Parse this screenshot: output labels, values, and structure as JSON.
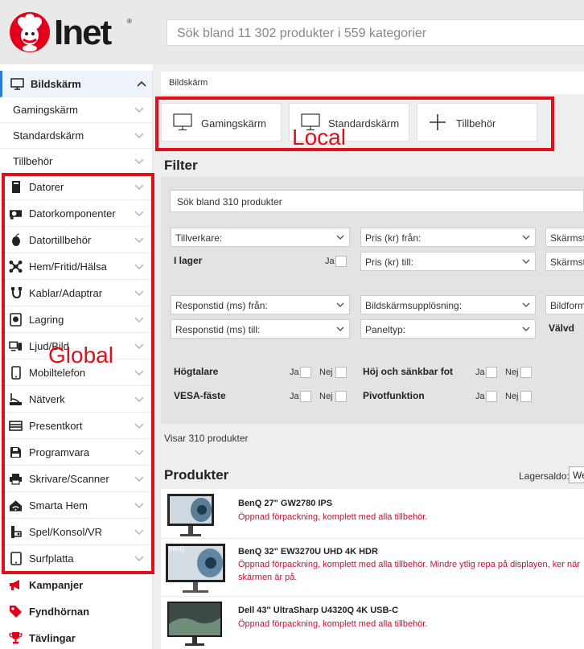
{
  "header": {
    "logo_text": "Inet",
    "logo_mark": "®",
    "search_placeholder": "Sök bland 11 302 produkter i 559 kategorier"
  },
  "sidebar": {
    "current": {
      "label": "Bildskärm",
      "icon": "monitor-icon"
    },
    "subcategories": [
      "Gamingskärm",
      "Standardskärm",
      "Tillbehör"
    ],
    "categories": [
      {
        "label": "Datorer",
        "icon": "desktop-tower-icon"
      },
      {
        "label": "Datorkomponenter",
        "icon": "graphics-card-icon"
      },
      {
        "label": "Datortillbehör",
        "icon": "mouse-icon"
      },
      {
        "label": "Hem/Fritid/Hälsa",
        "icon": "drone-icon"
      },
      {
        "label": "Kablar/Adaptrar",
        "icon": "cable-icon"
      },
      {
        "label": "Lagring",
        "icon": "hard-drive-icon"
      },
      {
        "label": "Ljud/Bild",
        "icon": "speaker-tv-icon"
      },
      {
        "label": "Mobiltelefon",
        "icon": "phone-icon"
      },
      {
        "label": "Nätverk",
        "icon": "router-icon"
      },
      {
        "label": "Presentkort",
        "icon": "gift-card-icon"
      },
      {
        "label": "Programvara",
        "icon": "floppy-icon"
      },
      {
        "label": "Skrivare/Scanner",
        "icon": "printer-icon"
      },
      {
        "label": "Smarta Hem",
        "icon": "smart-home-icon"
      },
      {
        "label": "Spel/Konsol/VR",
        "icon": "gamepad-icon"
      },
      {
        "label": "Surfplatta",
        "icon": "tablet-icon"
      }
    ],
    "extras": [
      {
        "label": "Kampanjer",
        "icon": "megaphone-icon"
      },
      {
        "label": "Fyndhörnan",
        "icon": "tag-icon"
      },
      {
        "label": "Tävlingar",
        "icon": "trophy-icon"
      }
    ]
  },
  "breadcrumb": "Bildskärm",
  "category_cards": [
    {
      "label": "Gamingskärm",
      "icon": "monitor-icon"
    },
    {
      "label": "Standardskärm",
      "icon": "monitor-icon"
    },
    {
      "label": "Tillbehör",
      "icon": "plus-icon"
    }
  ],
  "filter": {
    "title": "Filter",
    "search_placeholder": "Sök bland 310 produkter",
    "selects": {
      "tillverkare": "Tillverkare:",
      "pris_fran": "Pris (kr) från:",
      "pris_till": "Pris (kr) till:",
      "skarmst1": "Skärmstl",
      "skarmst2": "Skärmstl",
      "responstid_fran": "Responstid (ms) från:",
      "responstid_till": "Responstid (ms) till:",
      "upplosning": "Bildskärmsupplösning:",
      "paneltyp": "Paneltyp:",
      "bildform": "Bildform"
    },
    "labels": {
      "i_lager": "I lager",
      "valvd": "Välvd",
      "hogtalare": "Högtalare",
      "vesa": "VESA-fäste",
      "hoj_sank": "Höj och sänkbar fot",
      "pivot": "Pivotfunktion",
      "ja": "Ja",
      "nej": "Nej"
    }
  },
  "result_count": "Visar 310 produkter",
  "products_section": {
    "title": "Produkter",
    "stock_label": "Lagersaldo:",
    "stock_value": "We"
  },
  "products": [
    {
      "name": "BenQ 27\" GW2780 IPS",
      "desc": "Öppnad förpackning, komplett med alla tillbehör.",
      "brand": "benQ"
    },
    {
      "name": "BenQ 32\" EW3270U UHD 4K HDR",
      "desc": "Öppnad förpackning, komplett med alla tillbehör. Mindre ytlig repa på displayen, ker när skärmen är på.",
      "brand": "benQ"
    },
    {
      "name": "Dell 43'' UltraSharp U4320Q 4K USB-C",
      "desc": "Öppnad förpackning, komplett med alla tillbehör.",
      "brand": ""
    }
  ],
  "annotations": {
    "local": "Local",
    "global": "Global",
    "color": "#e0101a"
  },
  "colors": {
    "brand_red": "#e2001a",
    "accent_blue": "#2a7ad0",
    "description_red": "#c8102e"
  }
}
